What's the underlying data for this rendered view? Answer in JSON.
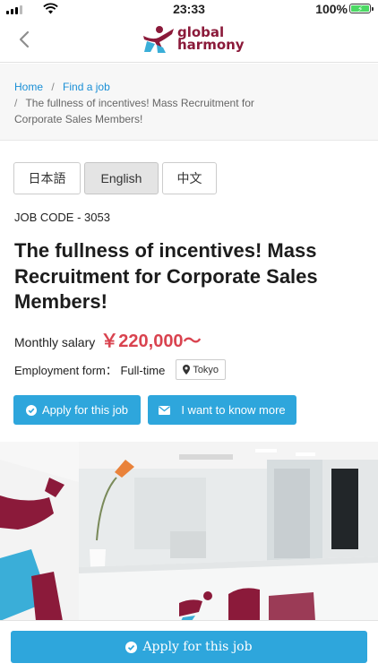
{
  "status_bar": {
    "time": "23:33",
    "battery": "100%"
  },
  "nav": {
    "logo_line1": "global",
    "logo_line2": "harmony",
    "back_icon": "chevron-left-icon"
  },
  "breadcrumb": {
    "home": "Home",
    "separator": "/",
    "find_job": "Find a job",
    "current": "The fullness of incentives! Mass Recruitment for Corporate Sales Members!"
  },
  "languages": [
    {
      "label": "日本語",
      "active": false
    },
    {
      "label": "English",
      "active": true
    },
    {
      "label": "中文",
      "active": false
    }
  ],
  "job": {
    "code": "JOB CODE - 3053",
    "title": "The fullness of incentives! Mass Recruitment for Corporate Sales Members!",
    "salary_label": "Monthly salary",
    "salary_value": "￥220,000～",
    "employment": "Employment form： Full-time",
    "location": "Tokyo"
  },
  "actions": {
    "apply": "Apply for this job",
    "know_more": "I want to know more"
  },
  "bottom": {
    "apply": "Apply for this job"
  },
  "colors": {
    "accent": "#2ea6dc",
    "salary": "#d9434f",
    "brand": "#8b1a3a"
  }
}
